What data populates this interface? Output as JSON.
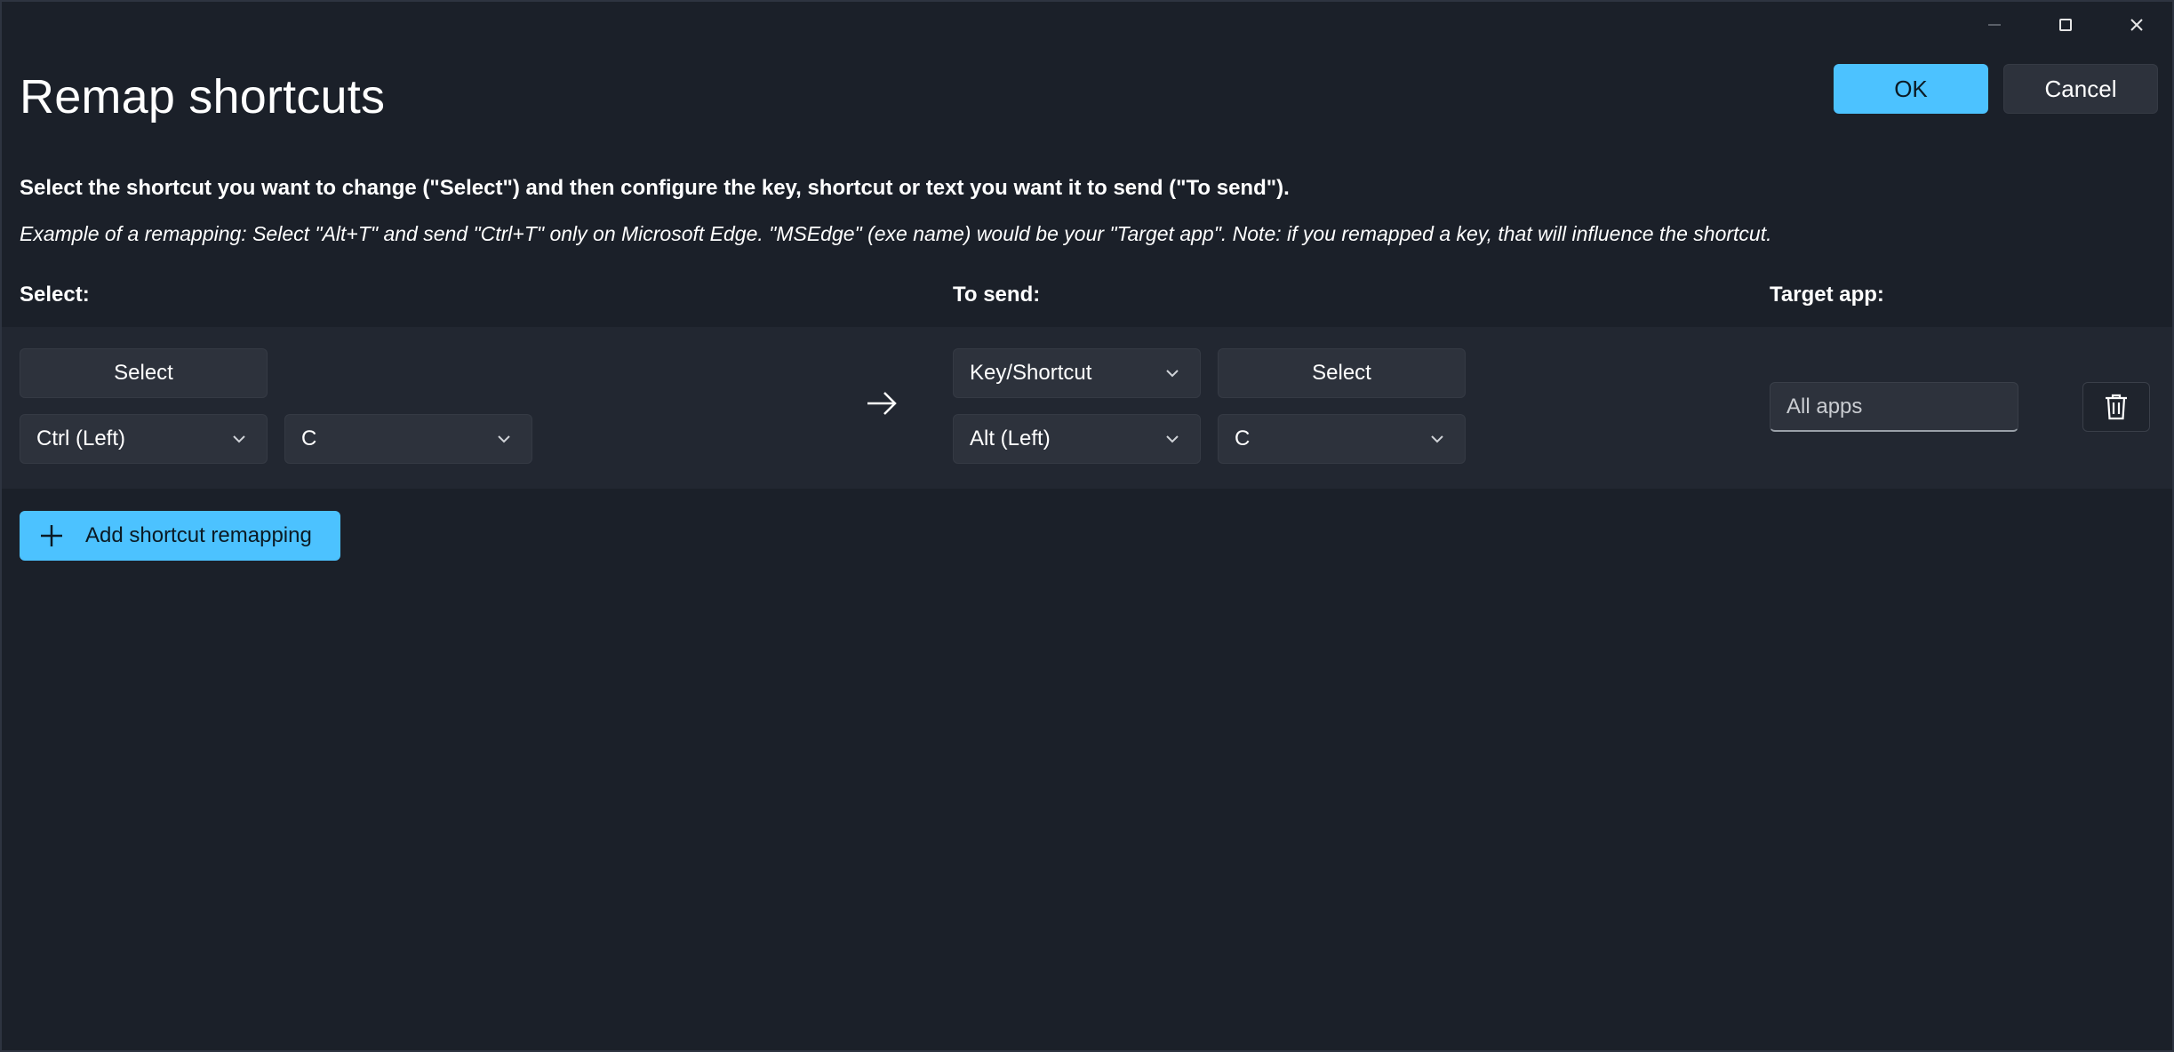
{
  "window": {
    "title": "Remap shortcuts",
    "ok_label": "OK",
    "cancel_label": "Cancel"
  },
  "caption_icons": [
    "minimize-icon",
    "maximize-icon",
    "close-icon"
  ],
  "description": "Select the shortcut you want to change (\"Select\") and then configure the key, shortcut or text you want it to send (\"To send\").",
  "example": "Example of a remapping: Select \"Alt+T\" and send \"Ctrl+T\" only on Microsoft Edge. \"MSEdge\" (exe name) would be your \"Target app\". Note: if you remapped a key, that will influence the shortcut.",
  "columns": {
    "select": "Select:",
    "to_send": "To send:",
    "target_app": "Target app:"
  },
  "remap_row": {
    "select_button": "Select",
    "select_key1": "Ctrl (Left)",
    "select_key2": "C",
    "arrow_icon": "arrow-right-icon",
    "send_type": "Key/Shortcut",
    "send_select_button": "Select",
    "send_key1": "Alt (Left)",
    "send_key2": "C",
    "target_app_placeholder": "All apps",
    "delete_icon": "trash-icon"
  },
  "add_button": "Add shortcut remapping",
  "colors": {
    "background": "#1b2029",
    "row_band": "#222731",
    "control": "#2d323c",
    "accent": "#4cc2ff"
  }
}
